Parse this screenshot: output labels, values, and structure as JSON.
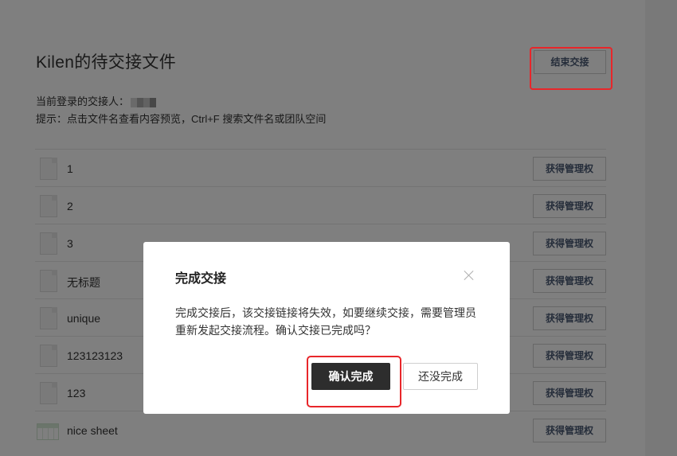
{
  "page": {
    "title": "Kilen的待交接文件",
    "end_button": "结束交接",
    "current_user_label": "当前登录的交接人：",
    "hint": "提示：点击文件名查看内容预览，Ctrl+F 搜索文件名或团队空间"
  },
  "files": [
    {
      "name": "1",
      "type": "doc",
      "action": "获得管理权"
    },
    {
      "name": "2",
      "type": "doc",
      "action": "获得管理权"
    },
    {
      "name": "3",
      "type": "doc",
      "action": "获得管理权"
    },
    {
      "name": "无标题",
      "type": "doc",
      "action": "获得管理权"
    },
    {
      "name": "unique",
      "type": "doc",
      "action": "获得管理权"
    },
    {
      "name": "123123123",
      "type": "doc",
      "action": "获得管理权"
    },
    {
      "name": "123",
      "type": "doc",
      "action": "获得管理权"
    },
    {
      "name": "nice sheet",
      "type": "sheet",
      "action": "获得管理权"
    }
  ],
  "modal": {
    "title": "完成交接",
    "body": "完成交接后，该交接链接将失效，如要继续交接，需要管理员重新发起交接流程。确认交接已完成吗？",
    "confirm_label": "确认完成",
    "cancel_label": "还没完成"
  },
  "colors": {
    "highlight": "#e8262a",
    "primary_button": "#2d2d2d",
    "secondary_text": "#4a5a75"
  }
}
